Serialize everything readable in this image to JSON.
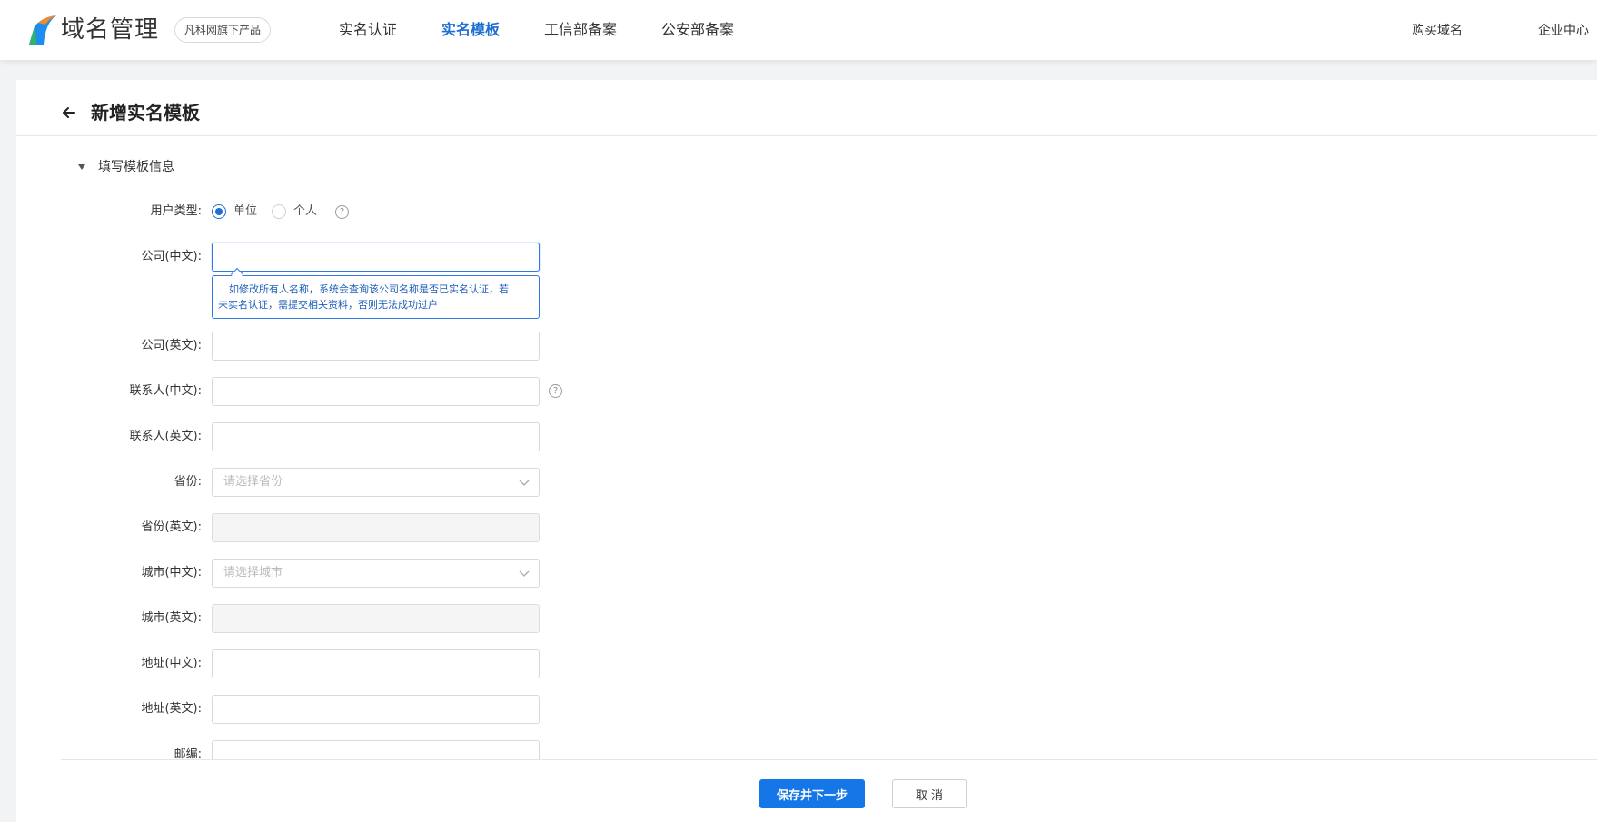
{
  "header": {
    "brand_title": "域名管理",
    "brand_badge": "凡科网旗下产品",
    "nav": [
      {
        "label": "实名认证",
        "active": false
      },
      {
        "label": "实名模板",
        "active": true
      },
      {
        "label": "工信部备案",
        "active": false
      },
      {
        "label": "公安部备案",
        "active": false
      }
    ],
    "right_links": [
      "购买域名",
      "企业中心"
    ]
  },
  "page": {
    "title": "新增实名模板",
    "section_title": "填写模板信息"
  },
  "form": {
    "user_type": {
      "label": "用户类型:",
      "options": [
        "单位",
        "个人"
      ],
      "selected": "单位"
    },
    "company_cn": {
      "label": "公司(中文):",
      "value": ""
    },
    "tooltip": {
      "line1": "如修改所有人名称，系统会查询该公司名称是否已实名认证，若",
      "line2": "未实名认证，需提交相关资料，否则无法成功过户"
    },
    "company_en": {
      "label": "公司(英文):",
      "value": ""
    },
    "contact_cn": {
      "label": "联系人(中文):",
      "value": ""
    },
    "contact_en": {
      "label": "联系人(英文):",
      "value": ""
    },
    "province": {
      "label": "省份:",
      "placeholder": "请选择省份"
    },
    "province_en": {
      "label": "省份(英文):",
      "value": ""
    },
    "city_cn": {
      "label": "城市(中文):",
      "placeholder": "请选择城市"
    },
    "city_en": {
      "label": "城市(英文):",
      "value": ""
    },
    "address_cn": {
      "label": "地址(中文):",
      "value": ""
    },
    "address_en": {
      "label": "地址(英文):",
      "value": ""
    },
    "postcode": {
      "label": "邮编:",
      "value": ""
    },
    "help_glyph": "?"
  },
  "footer": {
    "save_label": "保存并下一步",
    "cancel_label": "取 消"
  },
  "colors": {
    "accent": "#1576e8",
    "nav_active": "#1f6ed4",
    "tooltip_border": "#2c7be5"
  },
  "icons": [
    "logo-icon",
    "back-arrow-icon",
    "caret-down-icon",
    "help-icon",
    "chevron-down-icon"
  ]
}
